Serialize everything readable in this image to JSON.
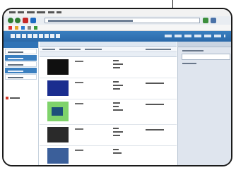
{
  "window": {
    "frame": "browser-window-callout"
  },
  "toolbar": {
    "back_color": "#2f7d32",
    "forward_color": "#2f7d32",
    "stop_color": "#c62828",
    "home_color": "#1e6bc2"
  },
  "banner": {
    "background": "#2f73b6"
  },
  "center": {
    "thumbnail_colors": [
      "#101010",
      "#1a2d8f",
      "#7fd36b",
      "#2a2a2a",
      "#3b5f9a"
    ]
  }
}
